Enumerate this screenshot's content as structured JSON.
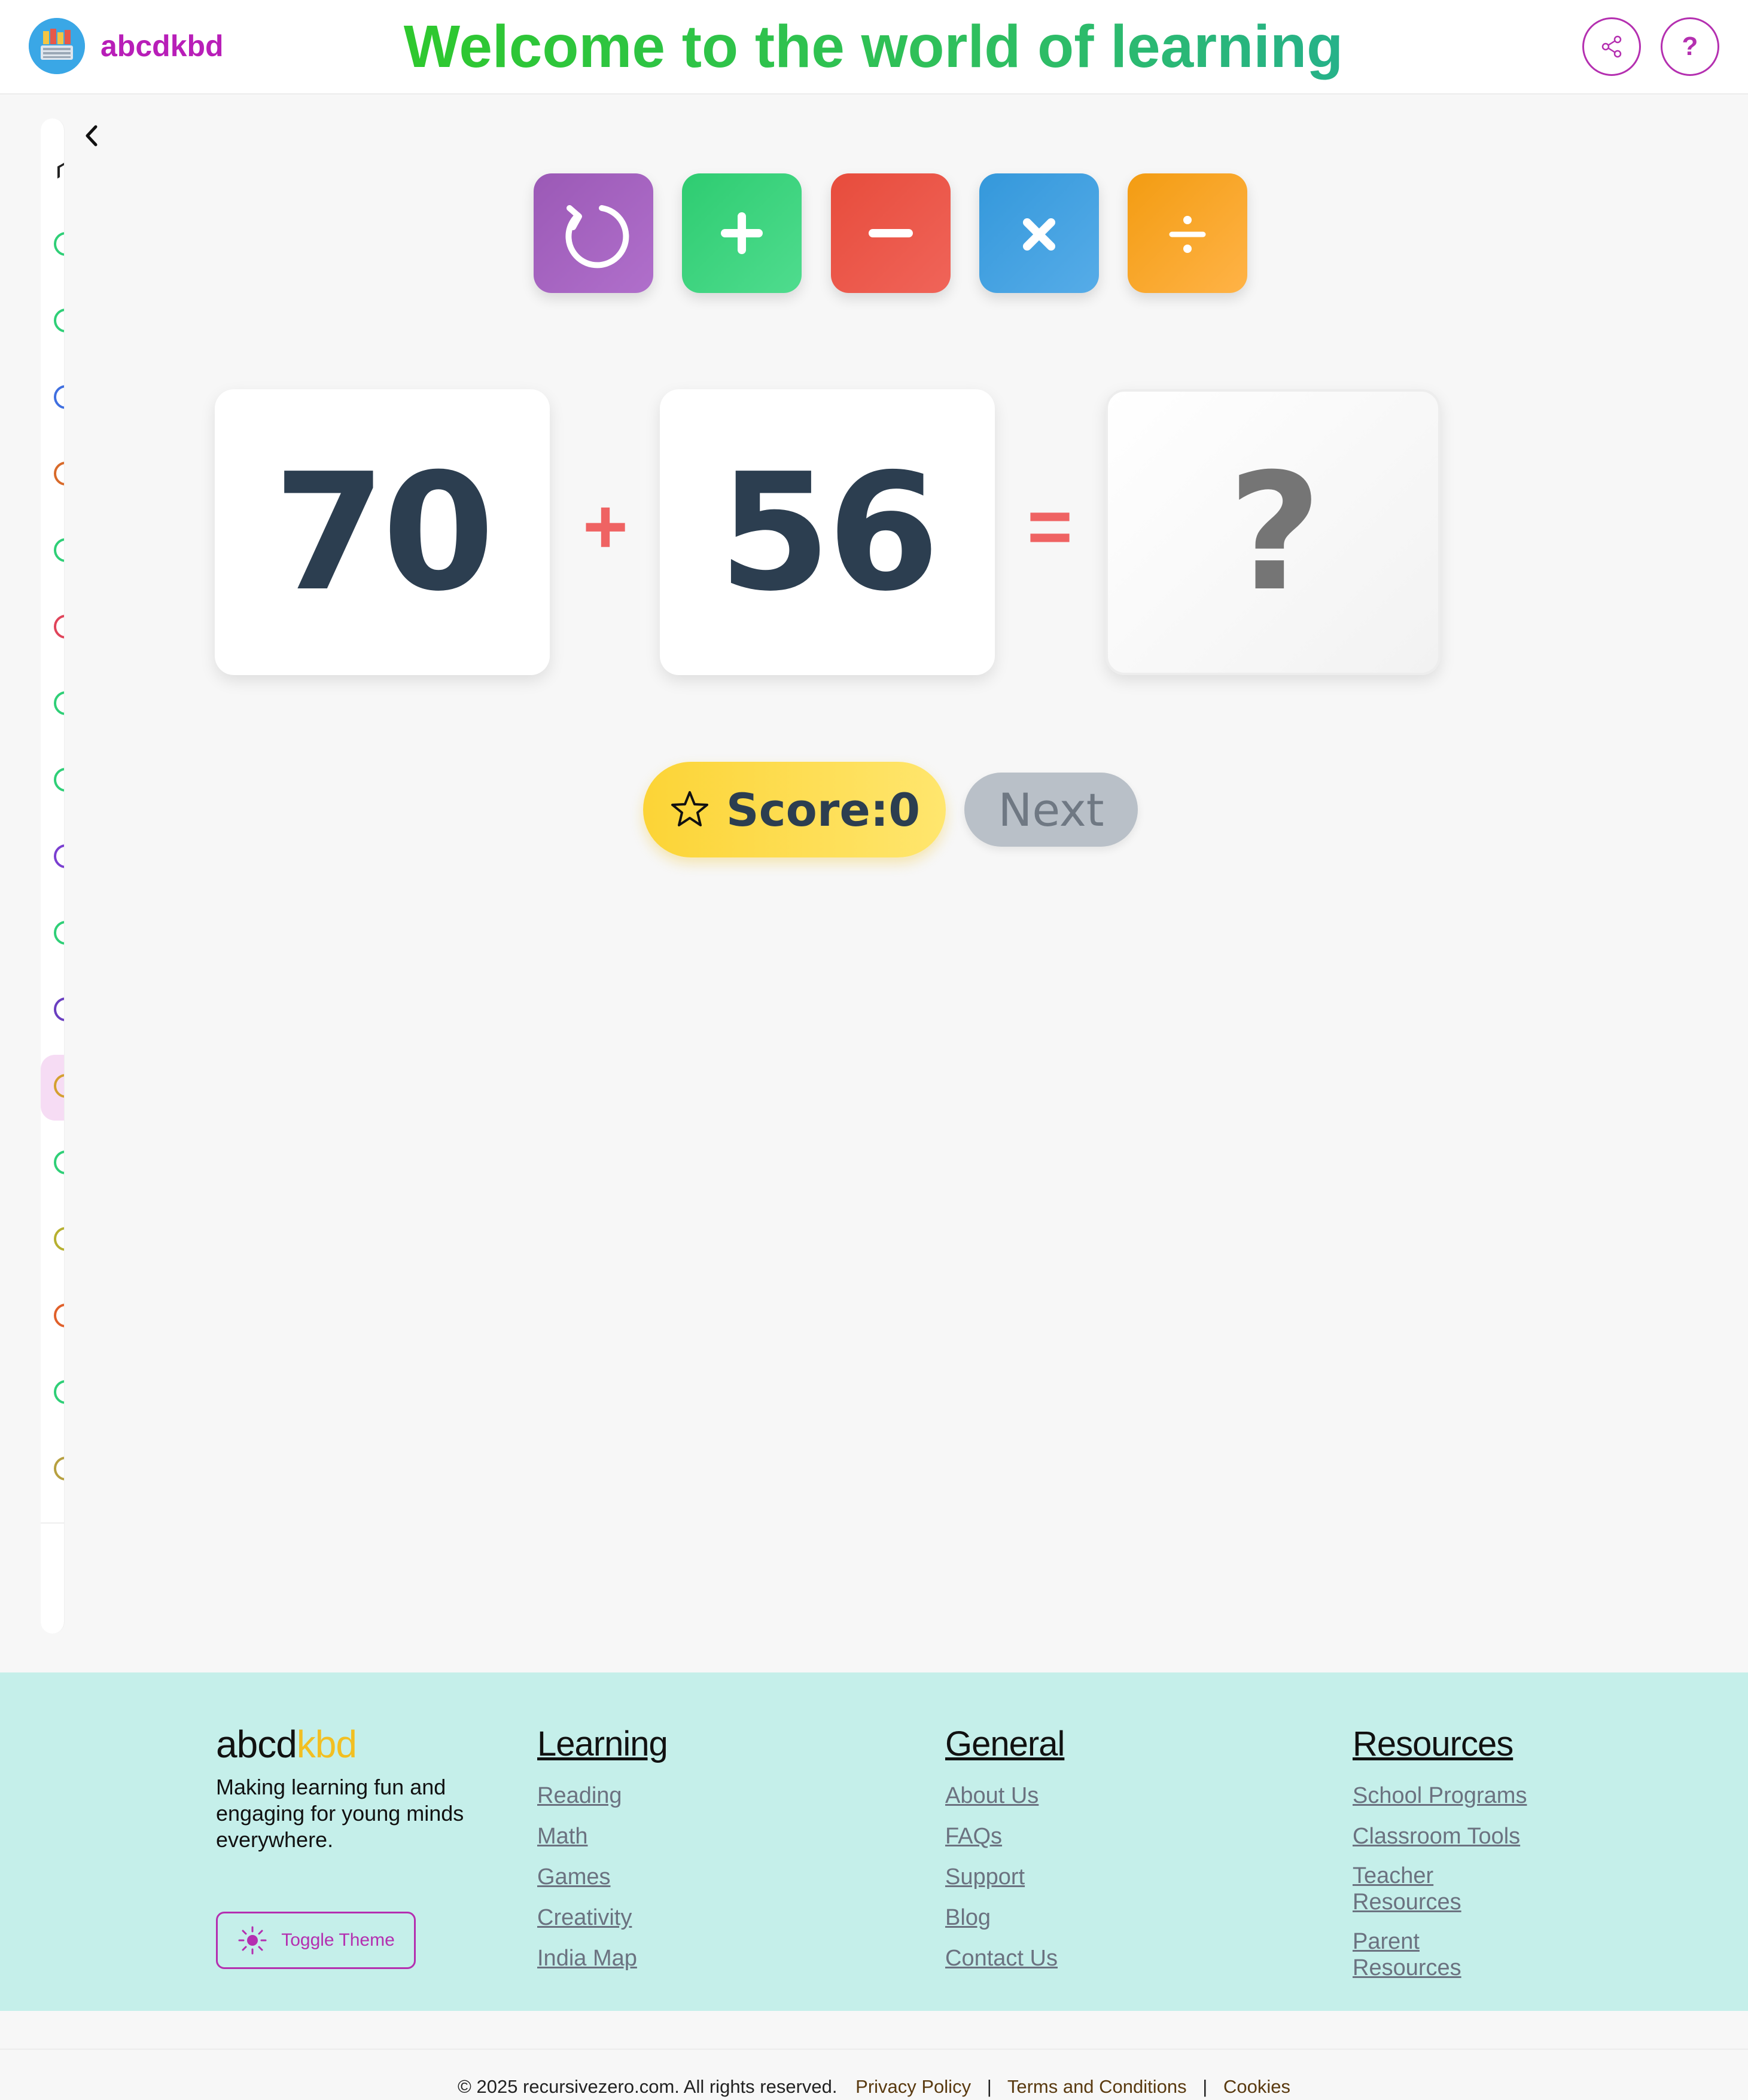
{
  "header": {
    "brand": "abcdkbd",
    "title": "Welcome to the world of learning",
    "help_label": "?"
  },
  "sidebar": {
    "icon_colors": [
      "#2fcf77",
      "#2fcf77",
      "#3f6fe0",
      "#d86a2a",
      "#2fcf77",
      "#e0445a",
      "#2fcf77",
      "#2fcf77",
      "#7a3fd0",
      "#2fcf77",
      "#6a3fc0",
      "#d4a030",
      "#2fcf77",
      "#b7b030",
      "#e0602a",
      "#2fcf77",
      "#b7a040"
    ],
    "active_index": 11
  },
  "operations": {
    "reset": "reset-icon",
    "add": "plus-icon",
    "subtract": "minus-icon",
    "multiply": "times-icon",
    "divide": "divide-icon"
  },
  "equation": {
    "a": "70",
    "op": "+",
    "b": "56",
    "eq": "=",
    "answer": "?"
  },
  "score": {
    "text": "Score:0"
  },
  "next_label": "Next",
  "footer": {
    "brand_main": "abcd",
    "brand_accent": "kbd",
    "tagline": "Making learning fun and engaging for young minds everywhere.",
    "toggle_theme": "Toggle Theme",
    "learning": {
      "title": "Learning",
      "links": [
        "Reading",
        "Math",
        "Games",
        "Creativity",
        "India Map"
      ]
    },
    "general": {
      "title": "General",
      "links": [
        "About Us",
        "FAQs",
        "Support",
        "Blog",
        "Contact Us"
      ]
    },
    "resources": {
      "title": "Resources",
      "links": [
        "School Programs",
        "Classroom Tools",
        "Teacher Resources",
        "Parent Resources"
      ]
    }
  },
  "bottom": {
    "copyright": "© 2025 recursivezero.com. All rights reserved.",
    "privacy": "Privacy Policy",
    "terms": "Terms and Conditions",
    "cookies": "Cookies",
    "separator": "|"
  },
  "colors": {
    "brand": "#b81eb8",
    "title_gradient": [
      "#2ec92a",
      "#25b08f"
    ],
    "footer_bg": "#c5efea",
    "accent_yellow": "#f2bf22"
  }
}
